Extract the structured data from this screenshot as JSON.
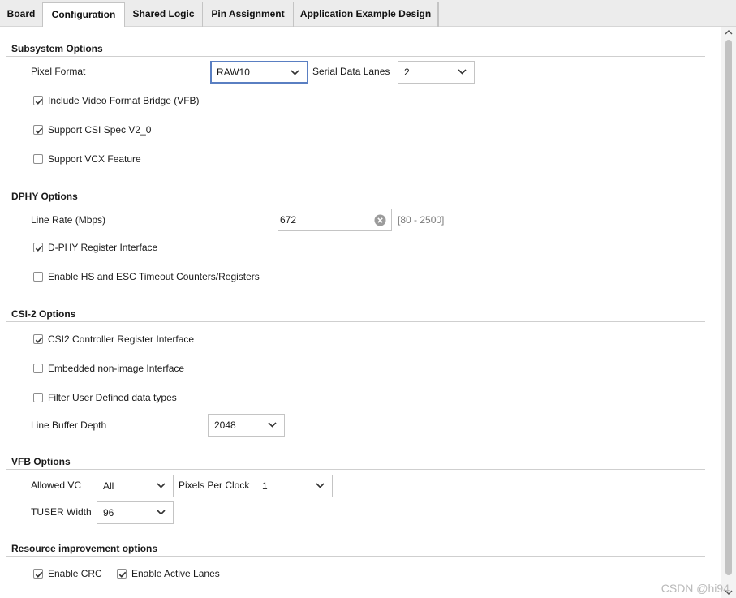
{
  "tabs": [
    {
      "label": "Board"
    },
    {
      "label": "Configuration"
    },
    {
      "label": "Shared Logic"
    },
    {
      "label": "Pin Assignment"
    },
    {
      "label": "Application Example Design"
    }
  ],
  "subsystem": {
    "title": "Subsystem Options",
    "pixel_format_label": "Pixel Format",
    "pixel_format_value": "RAW10",
    "serial_lanes_label": "Serial Data Lanes",
    "serial_lanes_value": "2",
    "vfb_label": "Include Video Format Bridge (VFB)",
    "vfb_checked": true,
    "csi_spec_label": "Support CSI Spec V2_0",
    "csi_spec_checked": true,
    "vcx_label": "Support VCX Feature",
    "vcx_checked": false
  },
  "dphy": {
    "title": "DPHY Options",
    "line_rate_label": "Line Rate (Mbps)",
    "line_rate_value": "672",
    "line_rate_range": "[80 - 2500]",
    "reg_iface_label": "D-PHY Register Interface",
    "reg_iface_checked": true,
    "timeout_label": "Enable HS and ESC Timeout Counters/Registers",
    "timeout_checked": false
  },
  "csi2": {
    "title": "CSI-2 Options",
    "ctrl_reg_label": "CSI2 Controller Register Interface",
    "ctrl_reg_checked": true,
    "embedded_label": "Embedded non-image Interface",
    "embedded_checked": false,
    "filter_label": "Filter User Defined data types",
    "filter_checked": false,
    "line_buffer_label": "Line Buffer Depth",
    "line_buffer_value": "2048"
  },
  "vfb": {
    "title": "VFB Options",
    "allowed_vc_label": "Allowed VC",
    "allowed_vc_value": "All",
    "ppc_label": "Pixels Per Clock",
    "ppc_value": "1",
    "tuser_label": "TUSER Width",
    "tuser_value": "96"
  },
  "resource": {
    "title": "Resource improvement options",
    "crc_label": "Enable CRC",
    "crc_checked": true,
    "active_lanes_label": "Enable Active Lanes",
    "active_lanes_checked": true
  },
  "watermark": "CSDN @hi94"
}
